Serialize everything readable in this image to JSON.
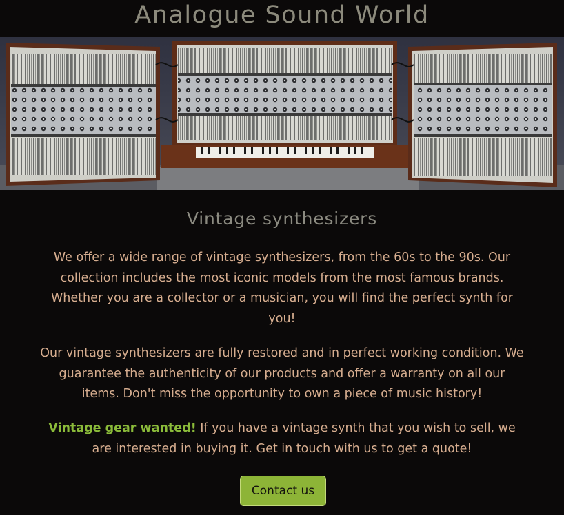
{
  "header": {
    "title": "Analogue Sound World"
  },
  "hero": {
    "image": "modular-synthesizer-photo"
  },
  "main": {
    "heading": "Vintage synthesizers",
    "paragraph1": "We offer a wide range of vintage synthesizers, from the 60s to the 90s. Our collection includes the most iconic models from the most famous brands. Whether you are a collector or a musician, you will find the perfect synth for you!",
    "paragraph2": "Our vintage synthesizers are fully restored and in perfect working condition. We guarantee the authenticity of our products and offer a warranty on all our items. Don't miss the opportunity to own a piece of music history!",
    "wanted_highlight": "Vintage gear wanted!",
    "wanted_text": " If you have a vintage synth that you wish to sell, we are interested in buying it. Get in touch with us to get a quote!",
    "contact_button": "Contact us"
  },
  "colors": {
    "background": "#0b0909",
    "title": "#8c8a7c",
    "body_text": "#d6ad8f",
    "accent_green": "#8bbb3a",
    "button_bg": "#8db437"
  }
}
